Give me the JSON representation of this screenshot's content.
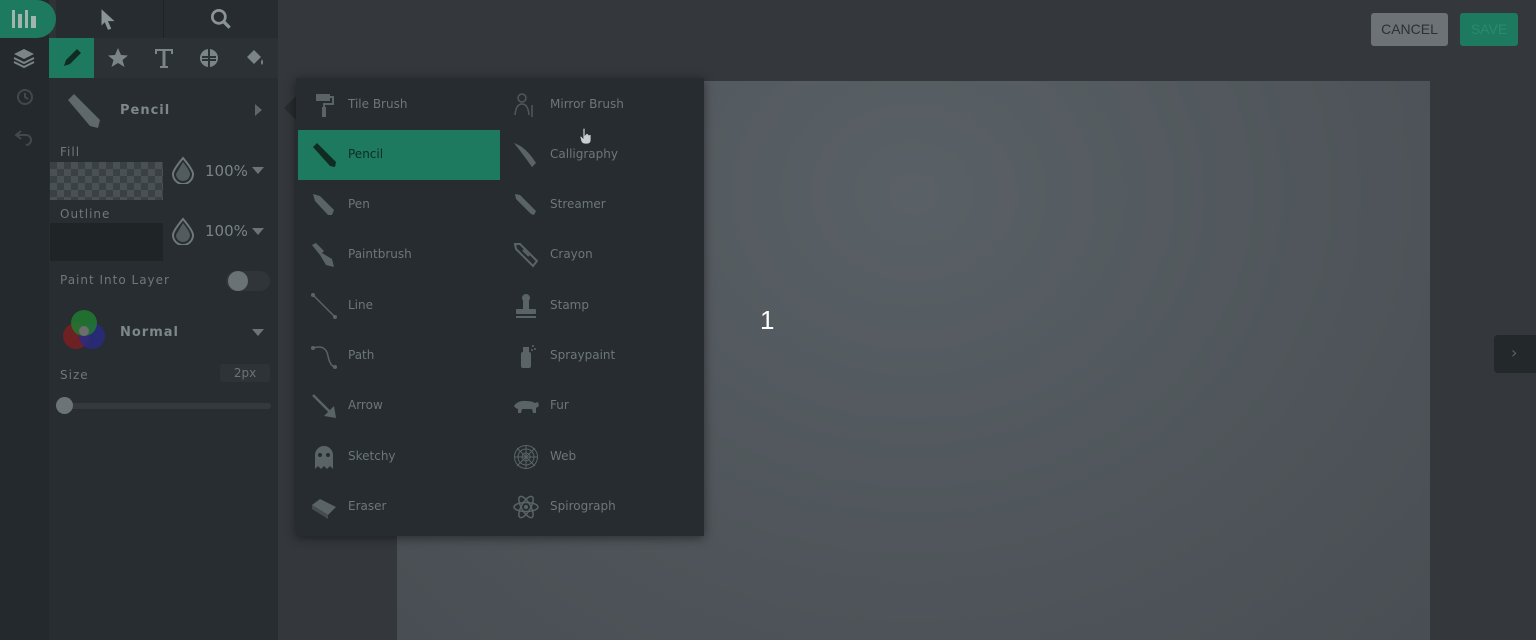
{
  "colors": {
    "accent": "#1d7a5e",
    "panel": "#272d30",
    "menu": "#262c2f",
    "canvas": "#4f565b"
  },
  "header": {
    "cancel_label": "CANCEL",
    "save_label": "SAVE"
  },
  "tool": {
    "current": "Pencil"
  },
  "fill": {
    "label": "Fill",
    "opacity": "100%"
  },
  "outline": {
    "label": "Outline",
    "opacity": "100%"
  },
  "paint_into_layer": {
    "label": "Paint Into Layer",
    "enabled": false
  },
  "blend": {
    "mode": "Normal"
  },
  "size": {
    "label": "Size",
    "value": "2px",
    "slider_fraction": 0.0
  },
  "canvas": {
    "label": "1"
  },
  "brush_menu": {
    "left": [
      {
        "label": "Tile Brush",
        "icon": "tile-brush-icon"
      },
      {
        "label": "Pencil",
        "icon": "pencil-icon",
        "selected": true
      },
      {
        "label": "Pen",
        "icon": "pen-icon"
      },
      {
        "label": "Paintbrush",
        "icon": "paintbrush-icon"
      },
      {
        "label": "Line",
        "icon": "line-icon"
      },
      {
        "label": "Path",
        "icon": "path-icon"
      },
      {
        "label": "Arrow",
        "icon": "arrow-icon"
      },
      {
        "label": "Sketchy",
        "icon": "sketchy-icon"
      },
      {
        "label": "Eraser",
        "icon": "eraser-icon"
      }
    ],
    "right": [
      {
        "label": "Mirror Brush",
        "icon": "mirror-brush-icon"
      },
      {
        "label": "Calligraphy",
        "icon": "calligraphy-icon"
      },
      {
        "label": "Streamer",
        "icon": "streamer-icon"
      },
      {
        "label": "Crayon",
        "icon": "crayon-icon"
      },
      {
        "label": "Stamp",
        "icon": "stamp-icon"
      },
      {
        "label": "Spraypaint",
        "icon": "spraypaint-icon"
      },
      {
        "label": "Fur",
        "icon": "fur-icon"
      },
      {
        "label": "Web",
        "icon": "web-icon"
      },
      {
        "label": "Spirograph",
        "icon": "spirograph-icon"
      }
    ]
  }
}
